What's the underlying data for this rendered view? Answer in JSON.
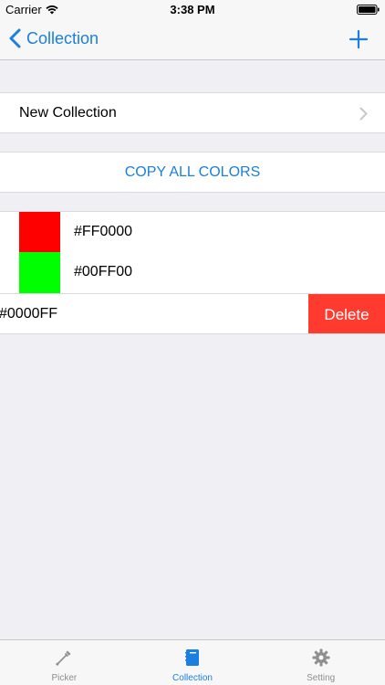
{
  "status_bar": {
    "carrier": "Carrier",
    "time": "3:38 PM"
  },
  "nav": {
    "back_label": "Collection",
    "add_icon": "plus-icon"
  },
  "collection": {
    "new_collection_label": "New Collection",
    "copy_all_label": "COPY ALL COLORS",
    "colors": [
      {
        "hex": "#FF0000",
        "swatch": "#FF0000"
      },
      {
        "hex": "#00FF00",
        "swatch": "#00FF00"
      }
    ],
    "swiped_color": {
      "hex": "#0000FF",
      "delete_label": "Delete"
    }
  },
  "tabs": [
    {
      "label": "Picker",
      "icon": "eyedropper-icon",
      "active": false
    },
    {
      "label": "Collection",
      "icon": "notebook-icon",
      "active": true
    },
    {
      "label": "Setting",
      "icon": "gear-icon",
      "active": false
    }
  ],
  "colors": {
    "accent": "#1A7FE0",
    "destructive": "#FF3B30",
    "background": "#EFEFF4",
    "inactive_tab": "#8E8E93"
  }
}
